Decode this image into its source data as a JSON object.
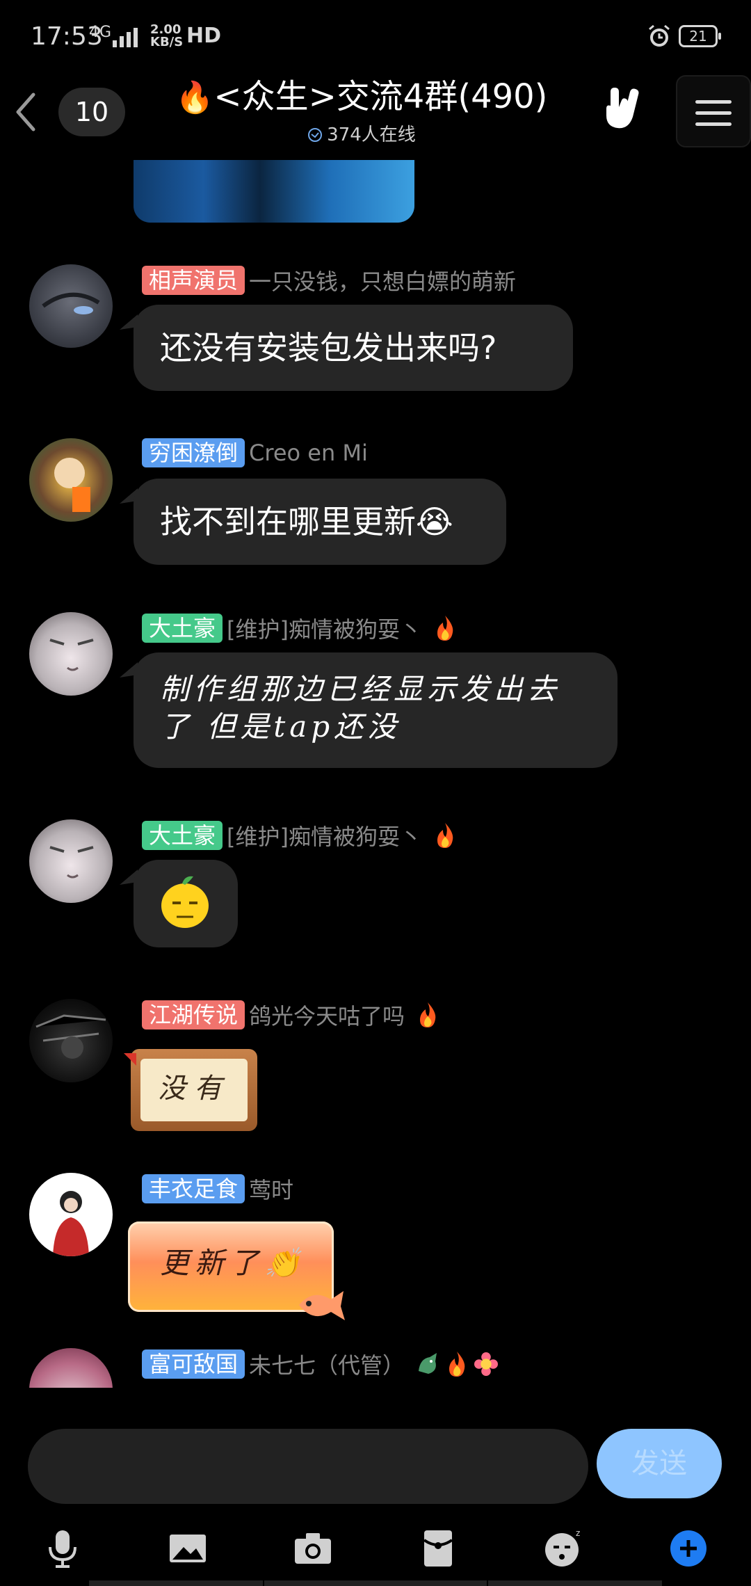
{
  "status_bar": {
    "time": "17:53",
    "network": "4G",
    "speed_value": "2.00",
    "speed_unit": "KB/S",
    "hd": "HD",
    "battery": "21"
  },
  "header": {
    "back_count": "10",
    "title_fire": "🔥",
    "title": "<众生>交流4群(490)",
    "online": "374人在线"
  },
  "messages": [
    {
      "tag": "相声演员",
      "tag_color": "#f0736d",
      "nick": "一只没钱，只想白嫖的萌新",
      "text": "还没有安装包发出来吗?"
    },
    {
      "tag": "穷困潦倒",
      "tag_color": "#5a9df0",
      "nick": "Creo en Mi",
      "text": "找不到在哪里更新😭"
    },
    {
      "tag": "大土豪",
      "tag_color": "#45c98a",
      "nick": "[维护]痴情被狗耍丶",
      "nick_emoji": "fire",
      "line1": "制作组那边已经显示发出去",
      "line2": "了  但是tap还没"
    },
    {
      "tag": "大土豪",
      "tag_color": "#45c98a",
      "nick": "[维护]痴情被狗耍丶",
      "nick_emoji": "fire",
      "sticker": "lemon-face"
    },
    {
      "tag": "江湖传说",
      "tag_color": "#f0736d",
      "nick": "鸽光今天咕了吗",
      "nick_emoji": "fire",
      "sticker_text": "没有"
    },
    {
      "tag": "丰衣足食",
      "tag_color": "#5a9df0",
      "nick": "莺时",
      "sticker_text": "更新了👏"
    },
    {
      "tag": "富可敌国",
      "tag_color": "#5a9df0",
      "nick": "未七七（代管）",
      "nick_emoji": "dragon-fire-flower"
    }
  ],
  "input": {
    "placeholder": "",
    "send_label": "发送"
  },
  "toolbar": {
    "icons": [
      "microphone-icon",
      "image-icon",
      "camera-icon",
      "red-packet-icon",
      "emoji-icon",
      "plus-icon"
    ]
  }
}
